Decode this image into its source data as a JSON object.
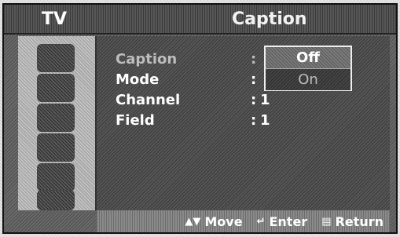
{
  "header": {
    "tab": "TV",
    "title": "Caption"
  },
  "sidebar": {
    "icons": [
      "picture-icon",
      "sound-icon",
      "channel-icon",
      "setup-icon",
      "input-icon",
      "guide-icon"
    ]
  },
  "menu": {
    "rows": [
      {
        "label": "Caption",
        "colon": ":",
        "value": ""
      },
      {
        "label": "Mode",
        "colon": ":",
        "value": ""
      },
      {
        "label": "Channel",
        "colon": ":",
        "value": "1"
      },
      {
        "label": "Field",
        "colon": ":",
        "value": "1"
      }
    ]
  },
  "dropdown": {
    "options": [
      "Off",
      "On"
    ],
    "selected": "Off"
  },
  "footer": {
    "move": "Move",
    "enter": "Enter",
    "return": "Return"
  }
}
